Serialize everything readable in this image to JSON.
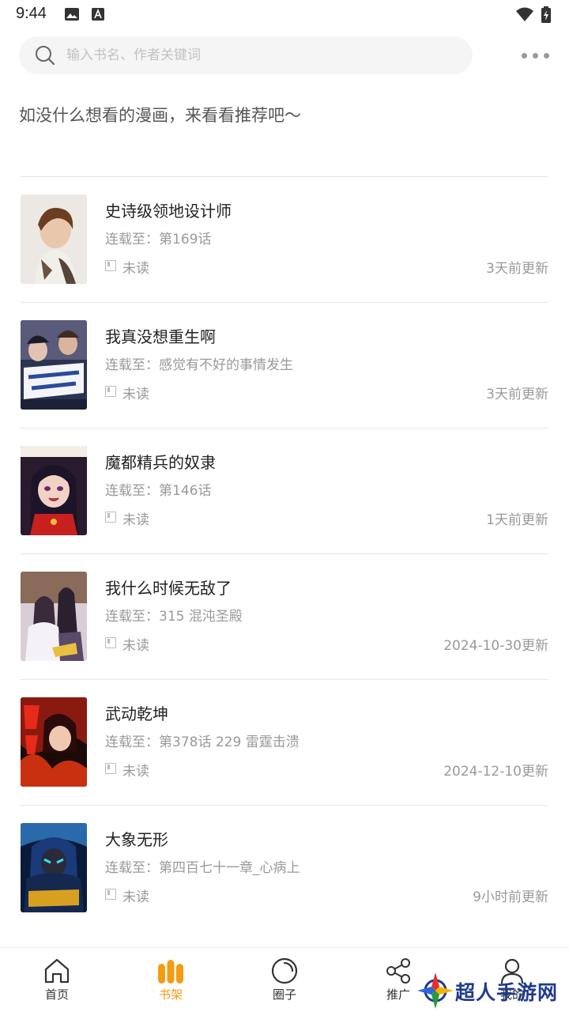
{
  "status_bar": {
    "time": "9:44"
  },
  "search": {
    "placeholder": "输入书名、作者关键词",
    "value": ""
  },
  "recommend_text": "如没什么想看的漫画，来看看推荐吧～",
  "books": [
    {
      "title": "史诗级领地设计师",
      "progress": "连载至：第169话",
      "read_status": "未读",
      "updated": "3天前更新"
    },
    {
      "title": "我真没想重生啊",
      "progress": "连载至：感觉有不好的事情发生",
      "read_status": "未读",
      "updated": "3天前更新"
    },
    {
      "title": "魔都精兵的奴隶",
      "progress": "连载至：第146话",
      "read_status": "未读",
      "updated": "1天前更新"
    },
    {
      "title": "我什么时候无敌了",
      "progress": "连载至：315 混沌圣殿",
      "read_status": "未读",
      "updated": "2024-10-30更新"
    },
    {
      "title": "武动乾坤",
      "progress": "连载至：第378话 229 雷霆击溃",
      "read_status": "未读",
      "updated": "2024-12-10更新"
    },
    {
      "title": "大象无形",
      "progress": "连载至：第四百七十一章_心病上",
      "read_status": "未读",
      "updated": "9小时前更新"
    }
  ],
  "nav": [
    {
      "label": "首页",
      "icon": "home-icon"
    },
    {
      "label": "书架",
      "icon": "bookshelf-icon",
      "active": true
    },
    {
      "label": "圈子",
      "icon": "circle-icon"
    },
    {
      "label": "推广",
      "icon": "share-icon"
    },
    {
      "label": "我的",
      "icon": "user-icon"
    }
  ],
  "watermark": {
    "text": "超人手游网"
  },
  "colors": {
    "accent": "#f39c12",
    "muted": "#999999"
  }
}
